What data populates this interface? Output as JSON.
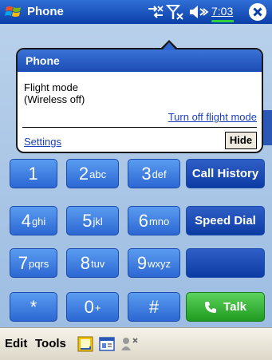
{
  "title_bar": {
    "app_title": "Phone",
    "clock": "7:03",
    "icons": [
      "windows-start-icon",
      "connectivity-icon",
      "signal-off-icon",
      "volume-icon",
      "close-icon"
    ]
  },
  "notification": {
    "header": "Phone",
    "message_line1": "Flight mode",
    "message_line2": "(Wireless off)",
    "action_link": "Turn off flight mode",
    "settings_link": "Settings",
    "hide_button": "Hide"
  },
  "keypad": {
    "keys": [
      {
        "digit": "1",
        "letters": ""
      },
      {
        "digit": "2",
        "letters": "abc"
      },
      {
        "digit": "3",
        "letters": "def"
      },
      {
        "digit": "4",
        "letters": "ghi"
      },
      {
        "digit": "5",
        "letters": "jkl"
      },
      {
        "digit": "6",
        "letters": "mno"
      },
      {
        "digit": "7",
        "letters": "pqrs"
      },
      {
        "digit": "8",
        "letters": "tuv"
      },
      {
        "digit": "9",
        "letters": "wxyz"
      },
      {
        "digit": "*",
        "letters": ""
      },
      {
        "digit": "0",
        "letters": "+"
      },
      {
        "digit": "#",
        "letters": ""
      }
    ],
    "call_history": "Call History",
    "speed_dial": "Speed Dial",
    "talk": "Talk"
  },
  "menu_bar": {
    "edit": "Edit",
    "tools": "Tools",
    "icons": [
      "notes-icon",
      "contacts-card-icon",
      "voice-mute-icon"
    ]
  },
  "colors": {
    "title_bar": "#0b3fa8",
    "key_blue": "#2c67d3",
    "key_dark": "#0d3ba4",
    "talk_green": "#1f9a1f",
    "link": "#1b3fc0"
  }
}
